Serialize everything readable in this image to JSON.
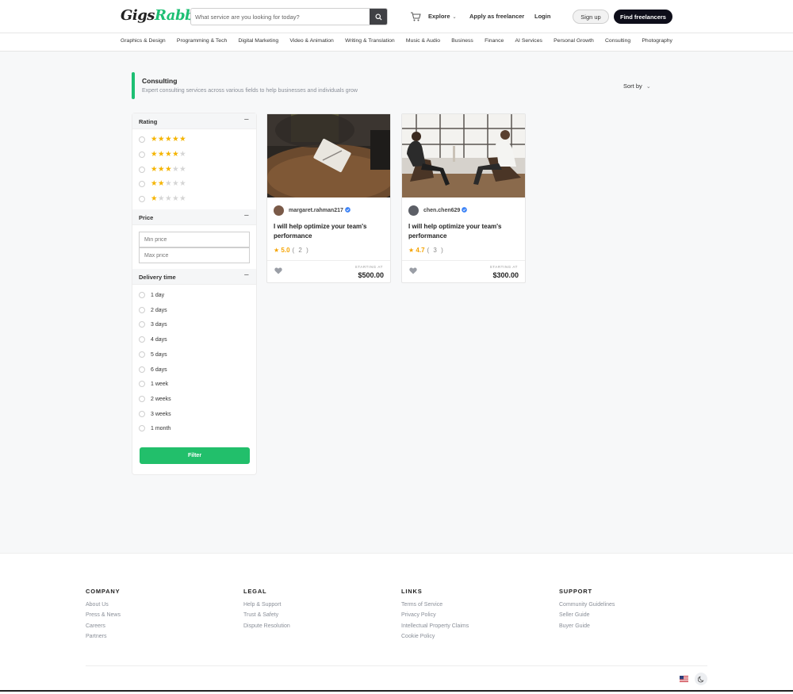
{
  "header": {
    "logo_main": "Gigs",
    "logo_accent": "Rabbit",
    "search_placeholder": "What service are you looking for today?",
    "explore": "Explore",
    "apply": "Apply as freelancer",
    "login": "Login",
    "signup": "Sign up",
    "find": "Find freelancers"
  },
  "categories": [
    "Graphics & Design",
    "Programming & Tech",
    "Digital Marketing",
    "Video & Animation",
    "Writing & Translation",
    "Music & Audio",
    "Business",
    "Finance",
    "AI Services",
    "Personal Growth",
    "Consulting",
    "Photography"
  ],
  "page": {
    "title": "Consulting",
    "subtitle": "Expert consulting services across various fields to help businesses and individuals grow",
    "sort_by": "Sort by"
  },
  "filters": {
    "rating_label": "Rating",
    "rating_options": [
      5,
      4,
      3,
      2,
      1
    ],
    "price_label": "Price",
    "min_price_placeholder": "Min price",
    "max_price_placeholder": "Max price",
    "delivery_label": "Delivery time",
    "delivery_options": [
      "1 day",
      "2 days",
      "3 days",
      "4 days",
      "5 days",
      "6 days",
      "1 week",
      "2 weeks",
      "3 weeks",
      "1 month"
    ],
    "filter_button": "Filter"
  },
  "gigs": [
    {
      "seller": "margaret.rahman217",
      "title": "I will help optimize your team's performance",
      "rating": "5.0",
      "reviews": "( 2 )",
      "starting_label": "STARTING AT",
      "price": "$500.00"
    },
    {
      "seller": "chen.chen629",
      "title": "I will help optimize your team's performance",
      "rating": "4.7",
      "reviews": "( 3 )",
      "starting_label": "STARTING AT",
      "price": "$300.00"
    }
  ],
  "footer": {
    "company": {
      "title": "COMPANY",
      "links": [
        "About Us",
        "Press & News",
        "Careers",
        "Partners"
      ]
    },
    "legal": {
      "title": "LEGAL",
      "links": [
        "Help & Support",
        "Trust & Safety",
        "Dispute Resolution"
      ]
    },
    "links": {
      "title": "LINKS",
      "links": [
        "Terms of Service",
        "Privacy Policy",
        "Intellectual Property Claims",
        "Cookie Policy"
      ]
    },
    "support": {
      "title": "SUPPORT",
      "links": [
        "Community Guidelines",
        "Seller Guide",
        "Buyer Guide"
      ]
    }
  },
  "colors": {
    "brand_green": "#1dbf73",
    "filter_green": "#22bf6b",
    "dark_button": "#0e0e1a",
    "star": "#f5b400"
  }
}
